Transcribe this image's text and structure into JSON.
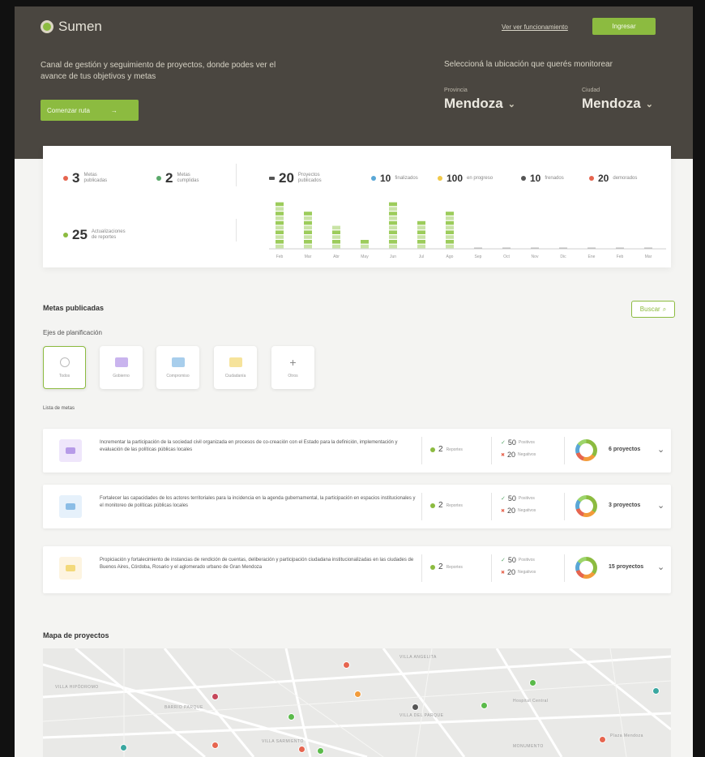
{
  "app": {
    "name": "Sumen"
  },
  "header": {
    "nav_link": "Ver ver funcionamiento",
    "login_label": "Ingresar"
  },
  "hero": {
    "tagline": "Canal de gestión y seguimiento de proyectos, donde podes ver el avance de tus objetivos y metas",
    "cta_label": "Comenzar ruta",
    "cta_arrow": "→",
    "select_prompt": "Seleccioná la ubicación que querés monitorear",
    "province_label": "Provincia",
    "province_value": "Mendoza",
    "city_label": "Ciudad",
    "city_value": "Mendoza",
    "chevron": "⌄"
  },
  "stats": {
    "metas_publicadas": {
      "value": "3",
      "label1": "Metas",
      "label2": "publicadas"
    },
    "metas_cumplidas": {
      "value": "2",
      "label1": "Metas",
      "label2": "cumplidas"
    },
    "proyectos": {
      "value": "20",
      "label1": "Proyectos",
      "label2": "publicados"
    },
    "finalizados": {
      "value": "10",
      "label": "finalizados"
    },
    "en_progreso": {
      "value": "100",
      "label": "en progreso"
    },
    "frenados": {
      "value": "10",
      "label": "frenados"
    },
    "demorados": {
      "value": "20",
      "label": "demorados"
    },
    "actualizaciones": {
      "value": "25",
      "label1": "Actualizaciones",
      "label2": "de reportes"
    }
  },
  "chart_data": {
    "type": "bar",
    "categories": [
      "Feb",
      "Mar",
      "Abr",
      "May",
      "Jun",
      "Jul",
      "Ago",
      "Sep",
      "Oct",
      "Nov",
      "Dic",
      "Ene",
      "Feb",
      "Mar"
    ],
    "values": [
      10,
      8,
      5,
      2,
      10,
      6,
      8,
      0,
      0,
      0,
      0,
      0,
      0,
      0
    ],
    "ylim": [
      0,
      10
    ],
    "xlabel": "",
    "ylabel": "",
    "colors": {
      "bar": "#9ccc5b",
      "bar_stripe": "#c9e3a6"
    }
  },
  "metas": {
    "title": "Metas publicadas",
    "search_label": "Buscar",
    "search_icon": "magnifier-icon",
    "ejes_label": "Ejes de planificación",
    "lista_label": "Lista de metas",
    "ejes": [
      {
        "label": "Todos",
        "icon": "circle-icon",
        "color": "#e4e4e4"
      },
      {
        "label": "Gobierno",
        "icon": "chat-icon",
        "color": "#b79be8"
      },
      {
        "label": "Compromiso",
        "icon": "megaphone-icon",
        "color": "#8bbde6"
      },
      {
        "label": "Ciudadanía",
        "icon": "bulb-icon",
        "color": "#f3d97a"
      },
      {
        "label": "Otros",
        "icon": "plus-icon",
        "color": "#ffffff"
      }
    ],
    "add_glyph": "+",
    "items": [
      {
        "text": "Incrementar la participación de la sociedad civil organizada en procesos de co-creación con el Estado para la definición, implementación y evaluación de las políticas públicas locales",
        "icon_color": "#efe6fb",
        "reports": "2",
        "reports_label": "Reportes",
        "positive": "50",
        "positive_label": "Positivos",
        "negative": "20",
        "negative_label": "Negativos",
        "projects": "6 proyectos"
      },
      {
        "text": "Fortalecer las capacidades de los actores territoriales para la incidencia en la agenda gubernamental, la participación en espacios institucionales y el monitoreo de políticas públicas locales",
        "icon_color": "#e6f1fb",
        "reports": "2",
        "reports_label": "Reportes",
        "positive": "50",
        "positive_label": "Positivos",
        "negative": "20",
        "negative_label": "Negativos",
        "projects": "3 proyectos"
      },
      {
        "text": "Propiciación y fortalecimiento de instancias de rendición de cuentas, deliberación y participación ciudadana institucionalizadas en las ciudades de Buenos Aires, Córdoba, Rosario y el aglomerado urbano de Gran Mendoza",
        "icon_color": "#fdf4e1",
        "reports": "2",
        "reports_label": "Reportes",
        "positive": "50",
        "positive_label": "Positivos",
        "negative": "20",
        "negative_label": "Negativos",
        "projects": "15 proyectos"
      }
    ],
    "check_glyph": "✓",
    "cross_glyph": "✖",
    "row_chevron": "⌄"
  },
  "map": {
    "title": "Mapa de proyectos",
    "places": [
      "VILLA HIPÓDROMO",
      "VILLA ANGELITA",
      "BARRIO PARQUE",
      "VILLA SARMIENTO",
      "VILLA DEL PARQUE",
      "Hospital Central",
      "Plaza Mendoza",
      "MONUMENTO"
    ]
  },
  "colors": {
    "brand": "#8cbb40",
    "header_bg": "#4a4640",
    "published": "#e6654f",
    "completed": "#5ba96b",
    "finalizados": "#5aa7d6",
    "progress": "#f1c94a",
    "frenados": "#555555",
    "demorados": "#e6654f"
  }
}
